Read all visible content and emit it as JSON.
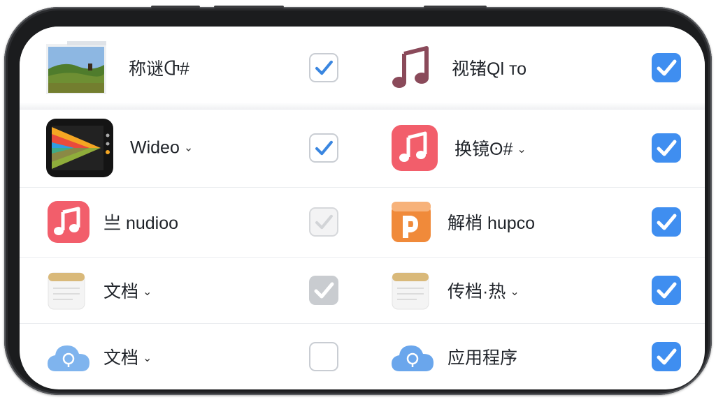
{
  "rows": [
    {
      "left": {
        "icon": "landscape-photo-icon",
        "label": "称谜Ⴇ#",
        "checked": true,
        "style": "outline"
      },
      "right": {
        "icon": "music-note-icon",
        "label": "视锗Ql то",
        "checked": true,
        "style": "filled"
      }
    },
    {
      "left": {
        "icon": "video-player-icon",
        "label": "Wideo",
        "checked": true,
        "style": "outline"
      },
      "right": {
        "icon": "music-app-icon",
        "label": "换镜ʘ#",
        "checked": true,
        "style": "filled"
      }
    },
    {
      "left": {
        "icon": "music-app-icon",
        "label": "亗 nudioo",
        "checked": true,
        "style": "disabled"
      },
      "right": {
        "icon": "orange-document-icon",
        "label": "解梢 hupco",
        "checked": true,
        "style": "filled"
      }
    },
    {
      "left": {
        "icon": "notes-calendar-icon",
        "label": "文档",
        "checked": true,
        "style": "greyfill"
      },
      "right": {
        "icon": "notes-calendar-icon",
        "label": "传档·热",
        "checked": true,
        "style": "filled"
      }
    },
    {
      "left": {
        "icon": "cloud-icon",
        "label": "文档",
        "checked": false,
        "style": "outline"
      },
      "right": {
        "icon": "cloud-icon",
        "label": "应用程序",
        "checked": true,
        "style": "filled"
      }
    }
  ],
  "colors": {
    "accent": "#3f8ef0",
    "music": "#f25e6b",
    "orange": "#f08a3a",
    "cloud": "#5a9ce8"
  }
}
